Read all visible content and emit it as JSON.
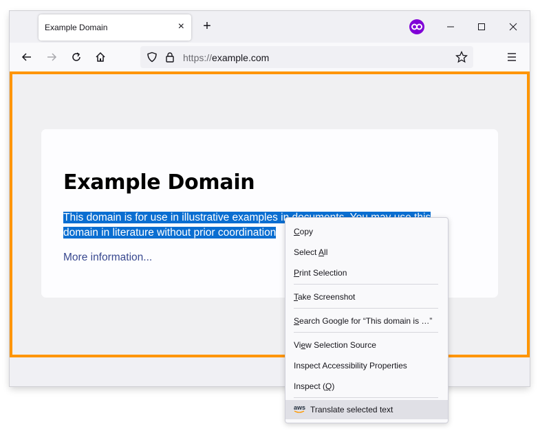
{
  "tab": {
    "title": "Example Domain",
    "close": "×",
    "new": "+"
  },
  "toolbar": {
    "url_scheme": "https://",
    "url_host": "example.com"
  },
  "page": {
    "heading": "Example Domain",
    "para_line1": "This domain is for use in illustrative examples in documents. You may use this",
    "para_line2": "domain in literature without prior coordination",
    "link": "More information..."
  },
  "context_menu": {
    "items": [
      {
        "pre": "",
        "key": "C",
        "post": "opy"
      },
      {
        "pre": "Select ",
        "key": "A",
        "post": "ll"
      },
      {
        "pre": "",
        "key": "P",
        "post": "rint Selection"
      },
      {
        "pre": "",
        "key": "T",
        "post": "ake Screenshot"
      },
      {
        "pre": "",
        "key": "S",
        "post": "earch Google for “This domain is …”"
      },
      {
        "pre": "Vi",
        "key": "e",
        "post": "w Selection Source"
      },
      {
        "pre": "Inspect Accessibility Properties",
        "key": "",
        "post": ""
      },
      {
        "pre": "Inspect (",
        "key": "Q",
        "post": ")"
      },
      {
        "pre": "Translate selected text",
        "key": "",
        "post": ""
      }
    ],
    "translate_icon": "aws"
  },
  "colors": {
    "accent_outline": "#ff9500",
    "selection": "#0a6ed1",
    "private": "#8000d7"
  }
}
